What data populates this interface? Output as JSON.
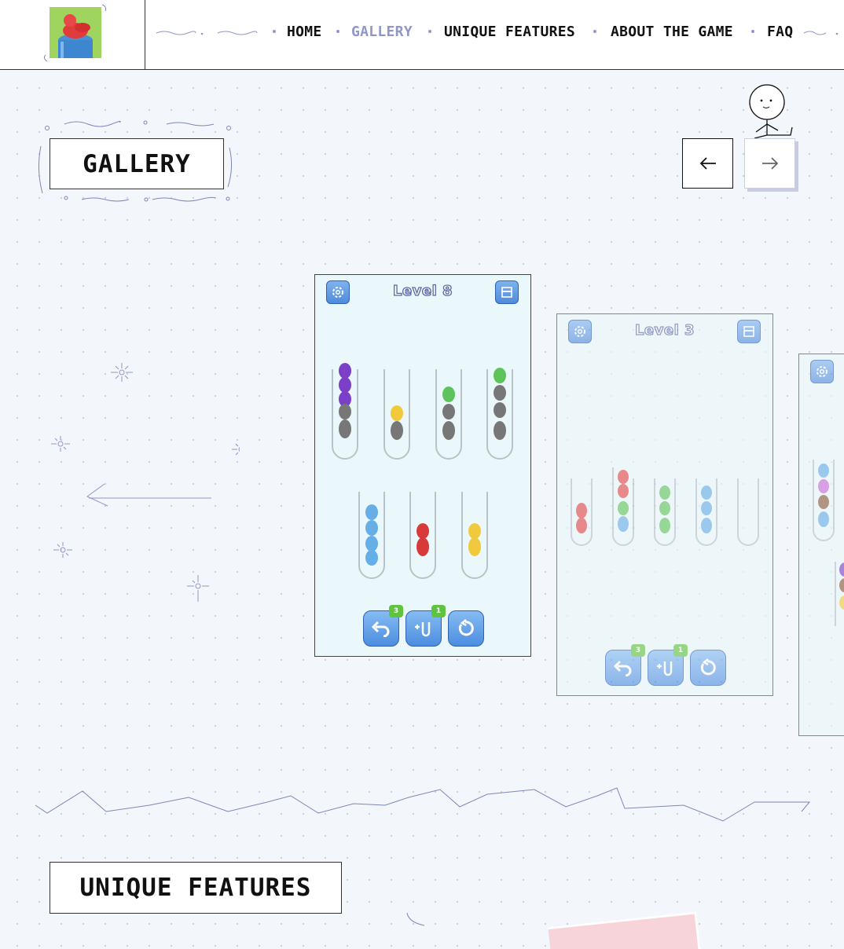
{
  "header": {
    "logo_alt": "game-logo",
    "nav": [
      {
        "label": "HOME",
        "active": false
      },
      {
        "label": "GALLERY",
        "active": true
      },
      {
        "label": "UNIQUE FEATURES",
        "active": false
      },
      {
        "label": "ABOUT THE GAME",
        "active": false
      },
      {
        "label": "FAQ",
        "active": false
      }
    ]
  },
  "gallery": {
    "title": "GALLERY",
    "prev_icon": "arrow-left-icon",
    "next_icon": "arrow-right-icon",
    "cards": [
      {
        "level": "Level 8",
        "undo_count": "3",
        "add_count": "1"
      },
      {
        "level": "Level 3",
        "undo_count": "3",
        "add_count": "1"
      },
      {
        "level": "",
        "undo_count": "",
        "add_count": ""
      }
    ]
  },
  "features": {
    "title": "UNIQUE FEATURES"
  },
  "colors": {
    "accent": "#8f97c8",
    "border": "#333333",
    "button_blue": "#4f8bdc",
    "badge_green": "#5ec33f"
  }
}
